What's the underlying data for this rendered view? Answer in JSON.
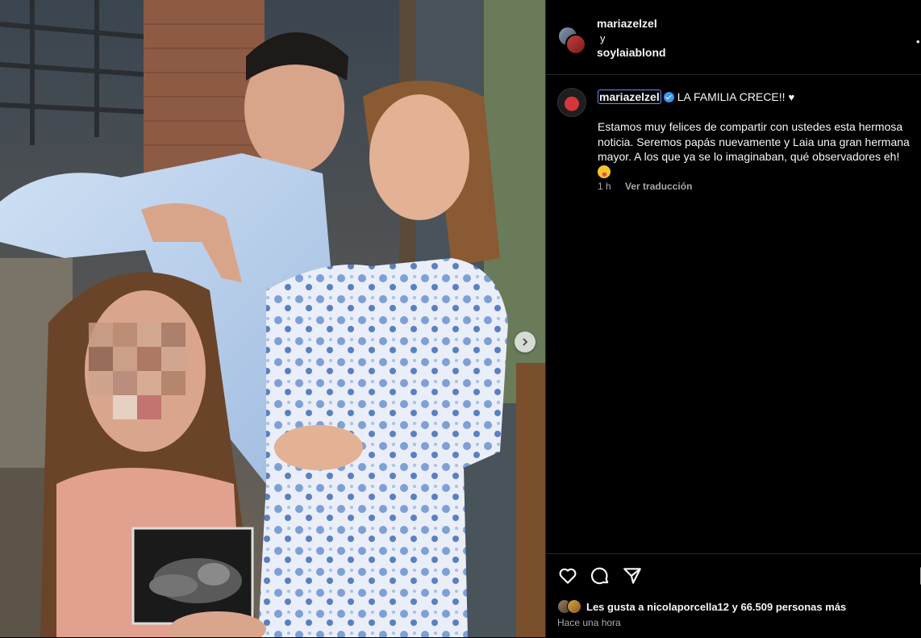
{
  "header": {
    "user1": "mariazelzel",
    "conjunction": "y",
    "user2": "soylaiablond"
  },
  "caption": {
    "username": "mariazelzel",
    "title": "LA FAMILIA CRECE!!",
    "heart": "♥",
    "body": "Estamos muy felices de compartir con ustedes esta hermosa noticia. Seremos papás nuevamente y Laia una gran hermana mayor. A los que ya se lo imaginaban, qué observadores eh!",
    "time": "1 h",
    "translate": "Ver traducción"
  },
  "likes": {
    "text": "Les gusta a nicolaporcella12 y 66.509 personas más",
    "post_time": "Hace una hora"
  },
  "icons": {
    "like": "heart-outline-icon",
    "comment": "comment-bubble-icon",
    "share": "paper-plane-icon",
    "save": "bookmark-icon",
    "next": "chevron-right-icon",
    "more": "more-dots-icon"
  },
  "colors": {
    "background": "#000000",
    "text": "#f5f5f5",
    "secondary_text": "#a8a8a8",
    "verified": "#3897f0",
    "divider": "#262626"
  }
}
